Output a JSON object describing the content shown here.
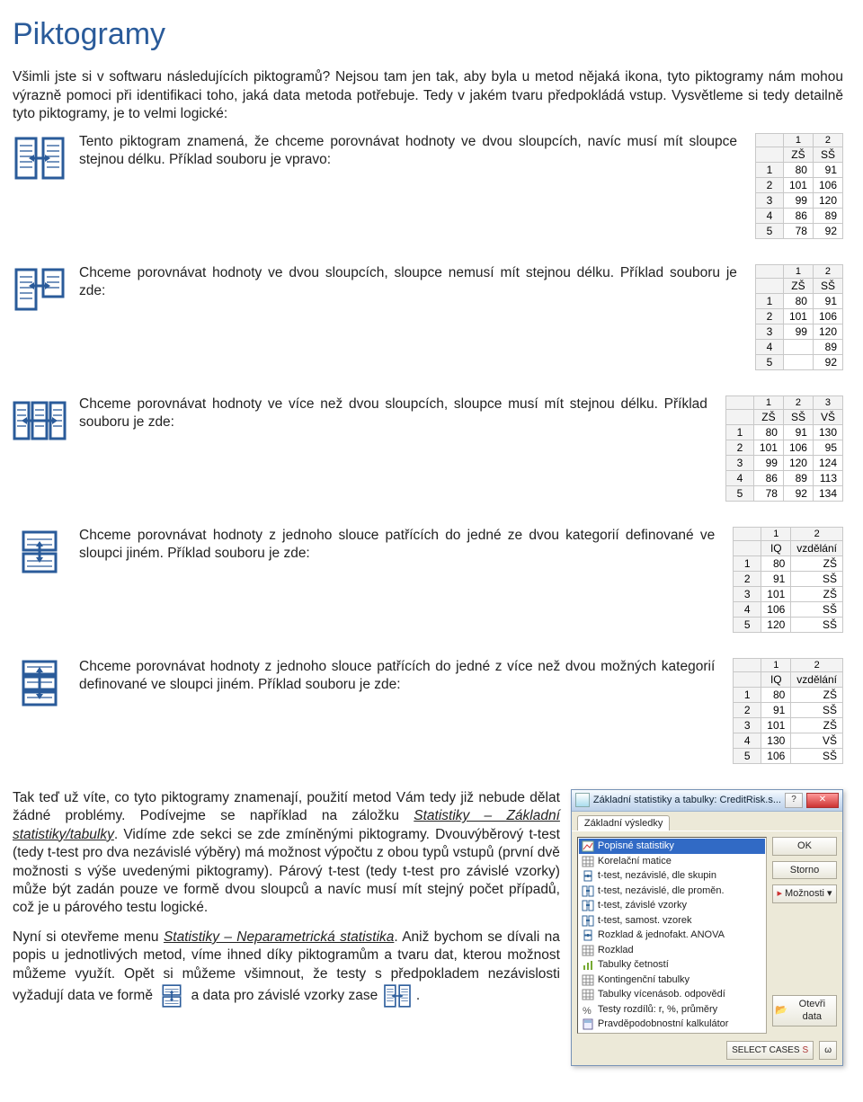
{
  "title": "Piktogramy",
  "intro": "Všimli jste si v softwaru následujících piktogramů? Nejsou tam jen tak, aby byla u metod nějaká ikona, tyto piktogramy nám mohou výrazně pomoci při identifikaci toho, jaká data metoda potřebuje. Tedy v jakém tvaru předpokládá vstup. Vysvětleme si tedy detailně tyto piktogramy, je to velmi logické:",
  "rows": [
    {
      "desc": "Tento piktogram znamená, že chceme porovnávat hodnoty ve dvou sloupcích, navíc musí mít sloupce stejnou délku. Příklad souboru je vpravo:"
    },
    {
      "desc": "Chceme porovnávat hodnoty ve dvou sloupcích, sloupce nemusí mít stejnou délku. Příklad souboru je zde:"
    },
    {
      "desc": "Chceme porovnávat hodnoty ve více než dvou sloupcích, sloupce musí mít stejnou délku. Příklad souboru je zde:"
    },
    {
      "desc": "Chceme porovnávat hodnoty z jednoho slouce patřících do jedné ze dvou kategorií definované ve sloupci jiném. Příklad souboru je zde:"
    },
    {
      "desc": "Chceme porovnávat hodnoty z jednoho slouce patřících do jedné z více než dvou možných kategorií definované ve sloupci jiném. Příklad souboru je zde:"
    }
  ],
  "tables": {
    "t1": {
      "topnums": [
        "1",
        "2"
      ],
      "headers": [
        "ZŠ",
        "SŠ"
      ],
      "rows": [
        [
          "1",
          "80",
          "91"
        ],
        [
          "2",
          "101",
          "106"
        ],
        [
          "3",
          "99",
          "120"
        ],
        [
          "4",
          "86",
          "89"
        ],
        [
          "5",
          "78",
          "92"
        ]
      ]
    },
    "t2": {
      "topnums": [
        "1",
        "2"
      ],
      "headers": [
        "ZŠ",
        "SŠ"
      ],
      "rows": [
        [
          "1",
          "80",
          "91"
        ],
        [
          "2",
          "101",
          "106"
        ],
        [
          "3",
          "99",
          "120"
        ],
        [
          "4",
          "",
          "89"
        ],
        [
          "5",
          "",
          "92"
        ]
      ]
    },
    "t3": {
      "topnums": [
        "1",
        "2",
        "3"
      ],
      "headers": [
        "ZŠ",
        "SŠ",
        "VŠ"
      ],
      "rows": [
        [
          "1",
          "80",
          "91",
          "130"
        ],
        [
          "2",
          "101",
          "106",
          "95"
        ],
        [
          "3",
          "99",
          "120",
          "124"
        ],
        [
          "4",
          "86",
          "89",
          "113"
        ],
        [
          "5",
          "78",
          "92",
          "134"
        ]
      ]
    },
    "t4": {
      "topnums": [
        "1",
        "2"
      ],
      "headers": [
        "IQ",
        "vzdělání"
      ],
      "rows": [
        [
          "1",
          "80",
          "ZŠ"
        ],
        [
          "2",
          "91",
          "SŠ"
        ],
        [
          "3",
          "101",
          "ZŠ"
        ],
        [
          "4",
          "106",
          "SŠ"
        ],
        [
          "5",
          "120",
          "SŠ"
        ]
      ]
    },
    "t5": {
      "topnums": [
        "1",
        "2"
      ],
      "headers": [
        "IQ",
        "vzdělání"
      ],
      "rows": [
        [
          "1",
          "80",
          "ZŠ"
        ],
        [
          "2",
          "91",
          "SŠ"
        ],
        [
          "3",
          "101",
          "ZŠ"
        ],
        [
          "4",
          "130",
          "VŠ"
        ],
        [
          "5",
          "106",
          "SŠ"
        ]
      ]
    }
  },
  "bottom": {
    "p1a": "Tak teď už víte, co tyto piktogramy znamenají, použití metod Vám tedy již nebude dělat žádné problémy. Podívejme se například na záložku ",
    "p1b": "Statistiky – Základní statistiky/tabulky",
    "p1c": ". Vidíme zde sekci se zde zmíněnými piktogramy. Dvouvýběrový t-test (tedy t-test pro dva nezávislé výběry) má možnost výpočtu z obou typů vstupů (první dvě možnosti s výše uvedenými piktogramy). Párový t-test (tedy t-test pro závislé vzorky) může být zadán pouze ve formě dvou sloupců a navíc musí mít stejný počet případů, což je u párového testu logické.",
    "p2a": "Nyní si otevřeme menu ",
    "p2b": "Statistiky – Neparametrická statistika",
    "p2c": ". Aniž bychom se dívali na popis u jednotlivých metod, víme ihned díky piktogramům a tvaru dat, kterou možnost můžeme využít. Opět si můžeme všimnout, že testy s předpokladem nezávislosti vyžadují data ve formě ",
    "p2d": " a data pro závislé vzorky zase ",
    "p2e": "."
  },
  "dialog": {
    "title": "Základní statistiky a tabulky: CreditRisk.s...",
    "tab": "Základní výsledky",
    "items": [
      {
        "label": "Popisné statistiky",
        "sel": true
      },
      {
        "label": "Korelační matice"
      },
      {
        "label": "t-test, nezávislé, dle skupin"
      },
      {
        "label": "t-test, nezávislé, dle proměn."
      },
      {
        "label": "t-test, závislé vzorky"
      },
      {
        "label": "t-test, samost. vzorek"
      },
      {
        "label": "Rozklad & jednofakt. ANOVA"
      },
      {
        "label": "Rozklad"
      },
      {
        "label": "Tabulky četností"
      },
      {
        "label": "Kontingenční tabulky"
      },
      {
        "label": "Tabulky vícenásob. odpovědí"
      },
      {
        "label": "Testy rozdílů: r, %, průměry"
      },
      {
        "label": "Pravděpodobnostní kalkulátor"
      }
    ],
    "buttons": {
      "ok": "OK",
      "cancel": "Storno",
      "options": "Možnosti",
      "open": "Otevři data"
    },
    "footer": {
      "select": "SELECT CASES",
      "weight": "ω"
    }
  }
}
